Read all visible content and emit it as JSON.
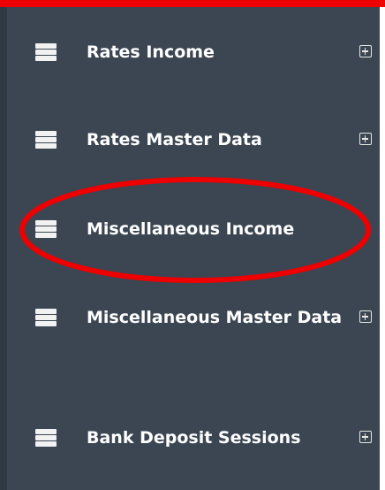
{
  "menu": {
    "items": [
      {
        "label": "Rates Income",
        "icon": "list-icon",
        "expand_icon": "plus-square-icon",
        "expandable": true
      },
      {
        "label": "Rates Master Data",
        "icon": "list-icon",
        "expand_icon": "plus-square-icon",
        "expandable": true
      },
      {
        "label": "Miscellaneous Income",
        "icon": "list-icon",
        "expandable": false,
        "highlighted": true
      },
      {
        "label": "Miscellaneous Master Data",
        "icon": "list-icon",
        "expand_icon": "plus-square-icon",
        "expandable": true
      },
      {
        "label": "Bank Deposit Sessions",
        "icon": "list-icon",
        "expand_icon": "plus-square-icon",
        "expandable": true
      }
    ]
  },
  "colors": {
    "sidebar_bg": "#3b4652",
    "text": "#ffffff",
    "annotation": "#ee0000"
  }
}
